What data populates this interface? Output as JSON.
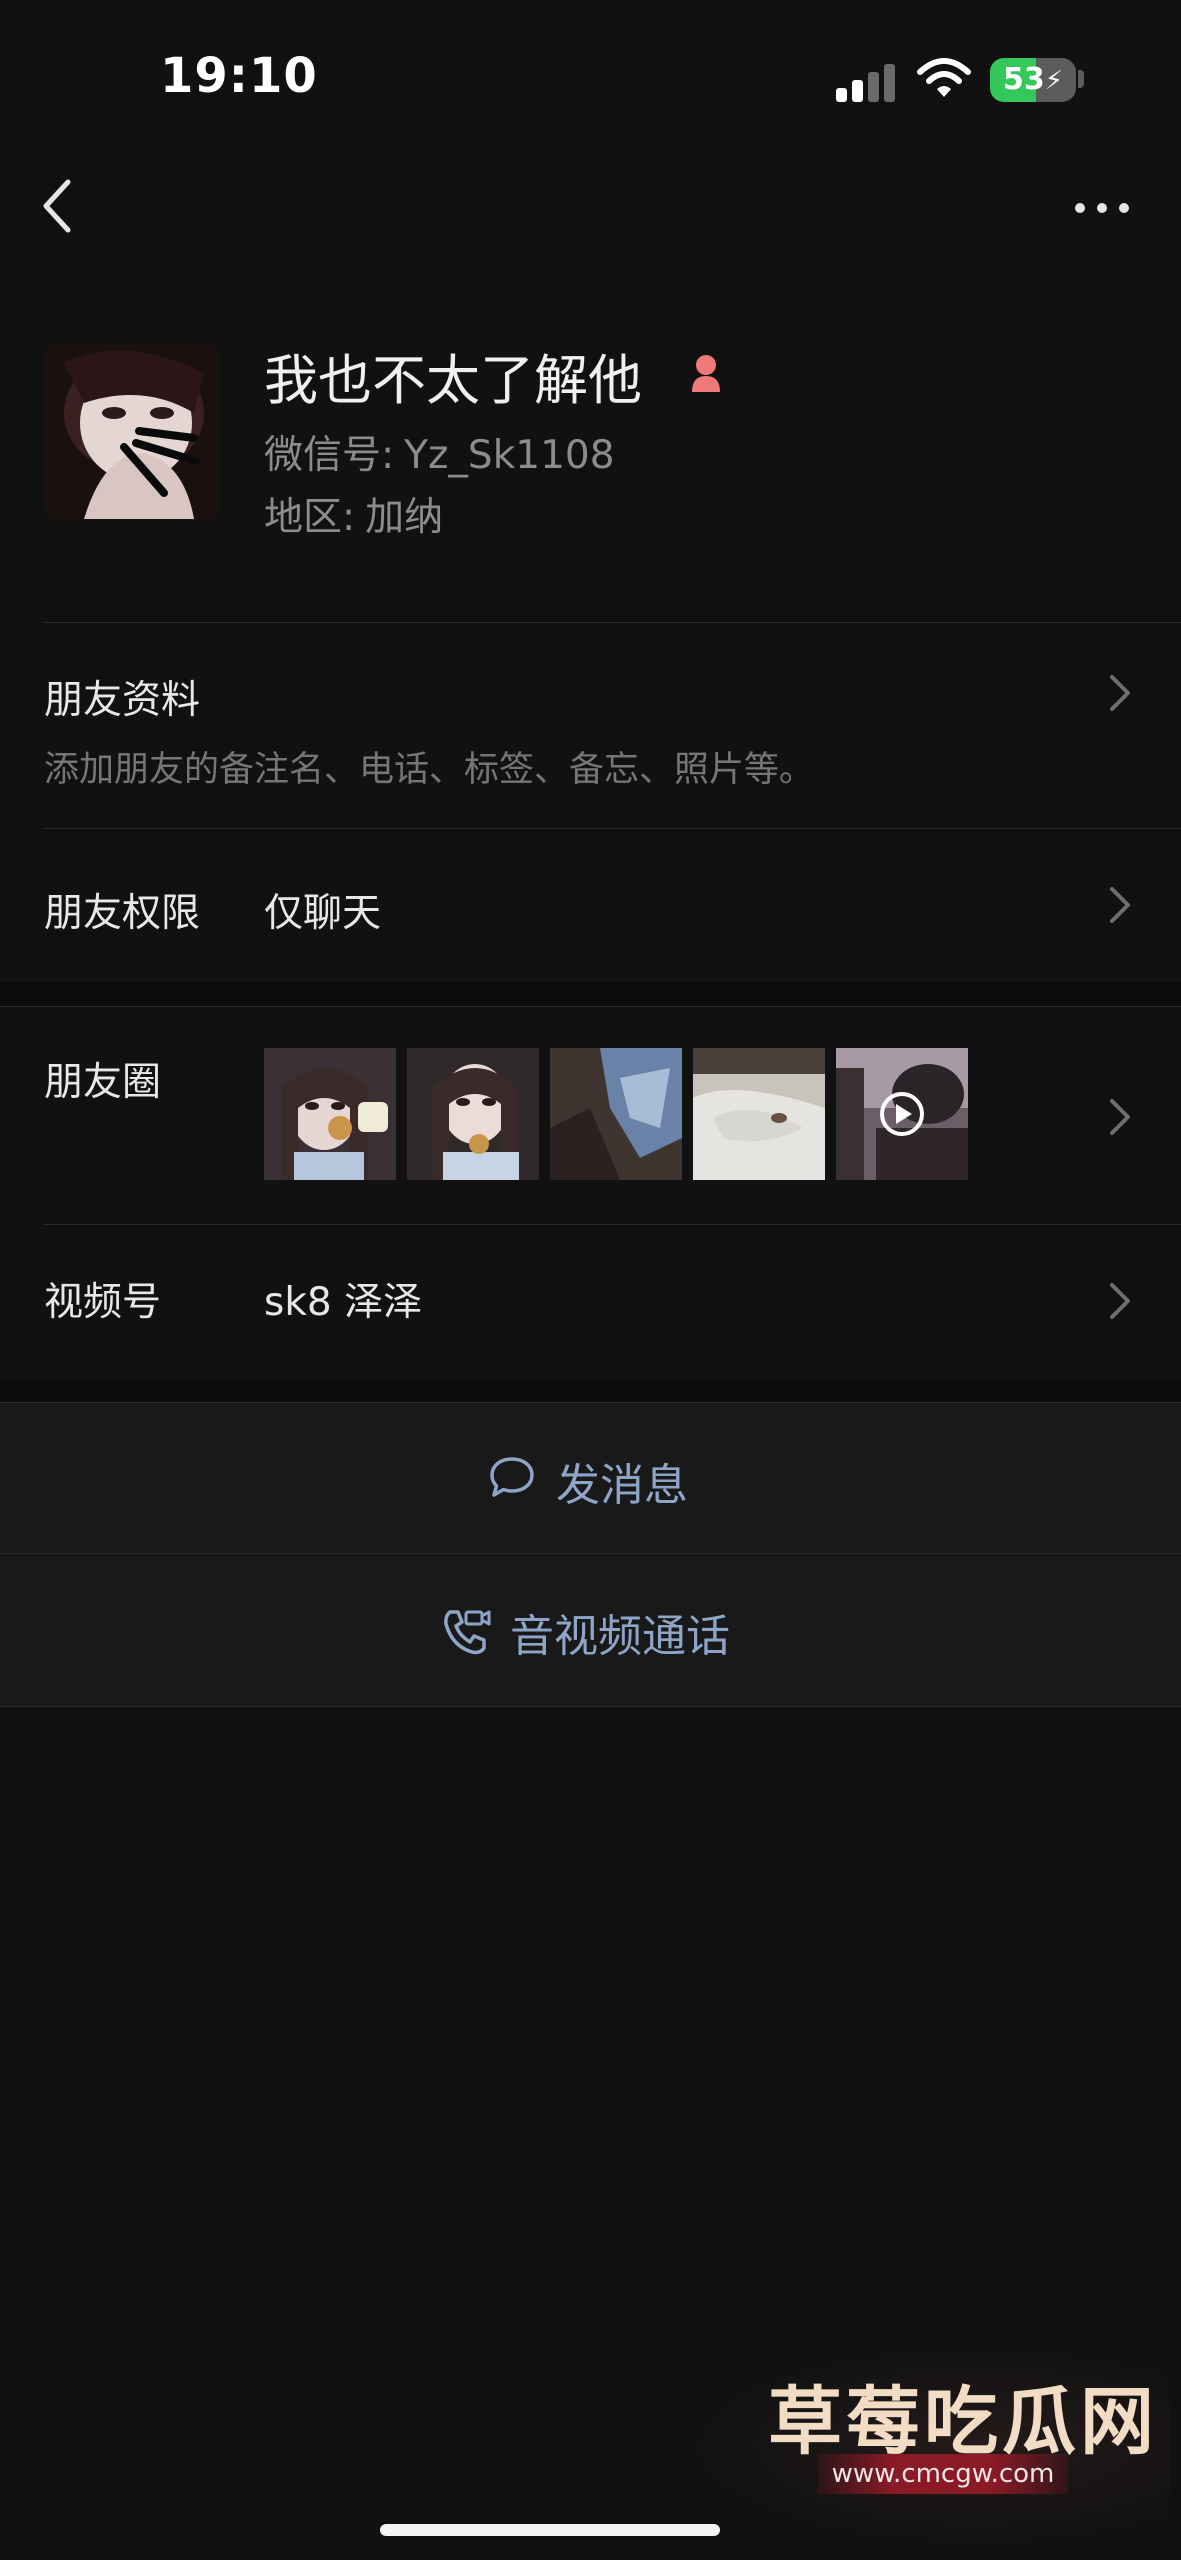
{
  "status_bar": {
    "time": "19:10",
    "battery_percent": "53",
    "battery_level": 0.53,
    "charging": true,
    "colors": {
      "battery_fill": "#34c759"
    }
  },
  "nav": {
    "back_icon": "chevron-left-icon",
    "more_icon": "ellipsis-icon"
  },
  "profile": {
    "nickname": "我也不太了解他",
    "gender_icon": "female-icon",
    "wechat_id_label": "微信号:",
    "wechat_id": "Yz_Sk1108",
    "region_label": "地区:",
    "region": "加纳"
  },
  "friend_info": {
    "title": "朋友资料",
    "description": "添加朋友的备注名、电话、标签、备忘、照片等。"
  },
  "permissions": {
    "label": "朋友权限",
    "value": "仅聊天"
  },
  "moments": {
    "label": "朋友圈",
    "thumbnails": [
      "photo",
      "photo",
      "photo",
      "photo",
      "video"
    ]
  },
  "channels": {
    "label": "视频号",
    "value": "sk8 泽泽"
  },
  "actions": {
    "message_label": "发消息",
    "message_icon": "chat-bubble-icon",
    "call_label": "音视频通话",
    "call_icon": "phone-video-icon"
  },
  "watermark": {
    "title": "草莓吃瓜网",
    "url": "www.cmcgw.com"
  },
  "colors": {
    "background": "#111111",
    "action_text": "#8fa5c8",
    "gender_icon": "#f07a7a"
  }
}
